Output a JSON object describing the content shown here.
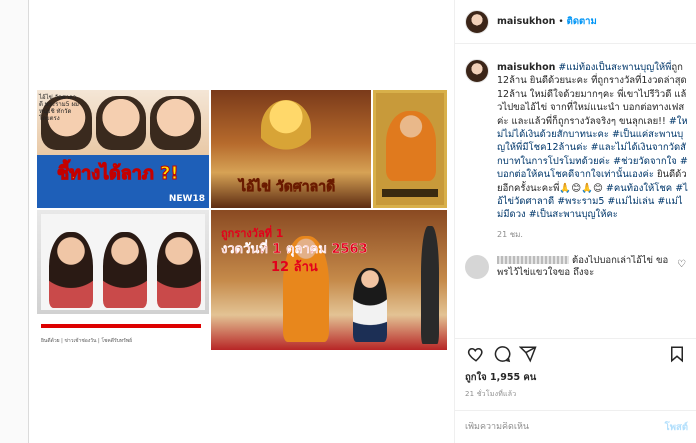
{
  "header": {
    "username": "maisukhon",
    "separator": "•",
    "follow_label": "ติดตาม"
  },
  "caption": {
    "username": "maisukhon",
    "segments": [
      {
        "text": "#แม่ท้องเป็นสะพานบุญให้พี่",
        "tag": true
      },
      {
        "text": "ถูก12ล้าน ยินดีด้วยนะคะ ที่ถูกรางวัลที่1งวดล่าสุด12ล้าน ใหม่ดีใจด้วยมากๆคะ พี่เขาไปรีวิวดี แล้วไปขอไอ้ไข่ จากที่ใหม่แนะนำ บอกต่อทางเฟสค่ะ และแล้วพี่ก็ถูกรางวัลจริงๆ ขนลุกเลย!! ",
        "tag": false
      },
      {
        "text": "#ใหม่ไม่ได้เงินด้วยสักบาทนะคะ",
        "tag": true
      },
      {
        "text": " ",
        "tag": false
      },
      {
        "text": "#เป็นแค่สะพานบุญให้พี่มีโชค12ล้านค่ะ",
        "tag": true
      },
      {
        "text": " ",
        "tag": false
      },
      {
        "text": "#และไม่ได้เงินจากวัดสักบาทในการโปรโมทด้วยค่ะ",
        "tag": true
      },
      {
        "text": " ",
        "tag": false
      },
      {
        "text": "#ช่วยวัดจากใจ",
        "tag": true
      },
      {
        "text": " ",
        "tag": false
      },
      {
        "text": "#บอกต่อให้คนโชคดีจากใจเท่านั้นเองค่ะ",
        "tag": true
      },
      {
        "text": " ยินดีด้วยอีกครั้งนะคะพี่🙏😊🙏😊 ",
        "tag": false
      },
      {
        "text": "#คนท้องให้โชค",
        "tag": true
      },
      {
        "text": " ",
        "tag": false
      },
      {
        "text": "#ไอ้ไข่วัดศาลาดี",
        "tag": true
      },
      {
        "text": " ",
        "tag": false
      },
      {
        "text": "#พระราม5",
        "tag": true
      },
      {
        "text": " ",
        "tag": false
      },
      {
        "text": "#แม่ไม่เล่น",
        "tag": true
      },
      {
        "text": " ",
        "tag": false
      },
      {
        "text": "#แม่ไม่มีดวง",
        "tag": true
      },
      {
        "text": " ",
        "tag": false
      },
      {
        "text": "#เป็นสะพานบุญให้คะ",
        "tag": true
      }
    ],
    "time": "21 ชม."
  },
  "comment": {
    "text": " ต้องไปบอกเล่าไอ้ไข่ ขอพรไว้ไข่แขวใจขอ ถึงจะ"
  },
  "actions": {
    "likes": "ถูกใจ 1,955 คน",
    "posted": "21 ชั่วโมงที่แล้ว"
  },
  "add_comment": {
    "placeholder": "เพิ่มความคิดเห็น",
    "post_label": "โพสต์"
  },
  "media": {
    "c1_small": "ไอ้ไข่ วัดศาลาดี พระราม5 ผมหนุ่ยชิ ทักวัดโดยตรง",
    "c1_big": "ชี้ทางได้ลาภ ?!",
    "c1_logo": "NEW18",
    "c2_caption": "ไอ้ไข่ วัดศาลาดี",
    "c4_text": "ยินดีด้วย | ข่าวเช้าช่องวัน | โชคดีรับทรัพย์",
    "c5_line1": "ถูกรางวัลที่ 1",
    "c5_line2": "งวดวันที่ 1 ตุลาคม 2563",
    "c5_line3": "12 ล้าน"
  }
}
